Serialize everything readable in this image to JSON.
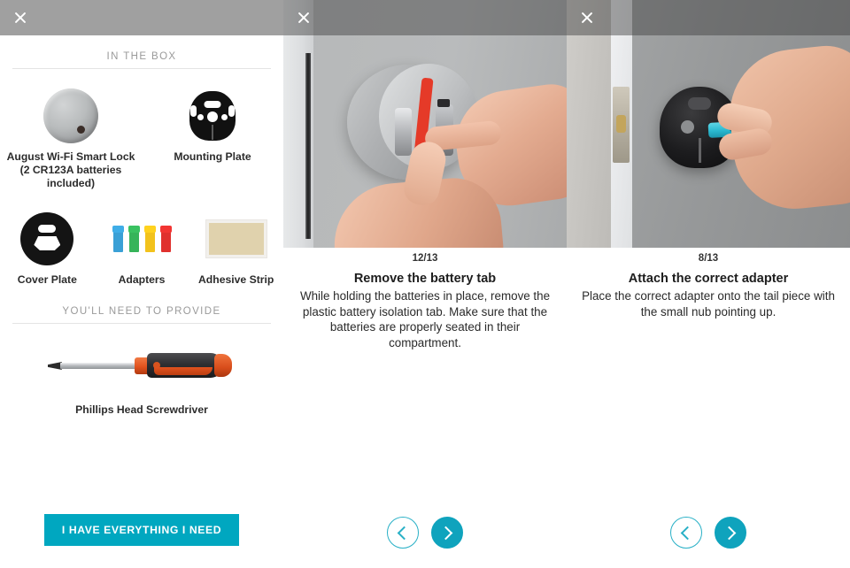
{
  "panels": {
    "checklist": {
      "close_label": "close-icon",
      "in_the_box_heading": "IN THE BOX",
      "in_the_box_items": [
        {
          "icon": "smart-lock-icon",
          "label": "August Wi-Fi Smart Lock\n(2 CR123A batteries included)"
        },
        {
          "icon": "mounting-plate-icon",
          "label": "Mounting Plate"
        },
        {
          "icon": "cover-plate-icon",
          "label": "Cover Plate"
        },
        {
          "icon": "adapters-icon",
          "label": "Adapters"
        },
        {
          "icon": "adhesive-strip-icon",
          "label": "Adhesive Strip"
        }
      ],
      "lock_label_line1": "August Wi-Fi Smart Lock",
      "lock_label_line2": "(2 CR123A batteries included)",
      "mounting_plate_label": "Mounting Plate",
      "cover_plate_label": "Cover Plate",
      "adapters_label": "Adapters",
      "adhesive_label": "Adhesive Strip",
      "provide_heading": "YOU'LL NEED TO PROVIDE",
      "screwdriver_label": "Phillips Head Screwdriver",
      "cta_label": "I HAVE EVERYTHING I NEED",
      "adapter_colors": [
        "#3aa0d6",
        "#36b45a",
        "#f2c21c",
        "#e0312e"
      ]
    },
    "step_battery": {
      "close_label": "close-icon",
      "step_count": "12/13",
      "title": "Remove the battery tab",
      "description": "While holding the batteries in place, remove the plastic battery isolation tab. Make sure that the batteries are properly seated in their compartment.",
      "prev_label": "chevron-left-icon",
      "next_label": "chevron-right-icon"
    },
    "step_adapter": {
      "close_label": "close-icon",
      "step_count": "8/13",
      "title": "Attach the correct adapter",
      "description": "Place the correct adapter onto the tail piece with the small nub pointing up.",
      "prev_label": "chevron-left-icon",
      "next_label": "chevron-right-icon"
    }
  },
  "theme": {
    "accent": "#00a7c0",
    "accent_outline": "#28b0c6",
    "heading_gray": "#9a9a9a",
    "text_dark": "#1d1d1d"
  }
}
